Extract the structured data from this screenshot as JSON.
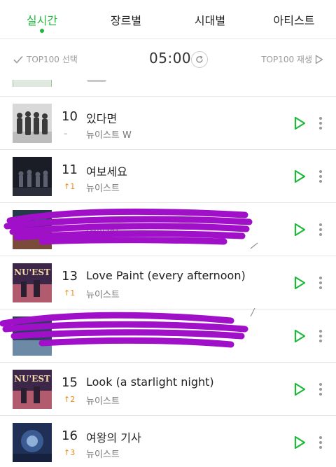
{
  "tabs": [
    {
      "label": "실시간",
      "active": true
    },
    {
      "label": "장르별",
      "active": false
    },
    {
      "label": "시대별",
      "active": false
    },
    {
      "label": "아티스트",
      "active": false
    }
  ],
  "toolbar": {
    "select_label": "TOP100 선택",
    "timer": "05:00",
    "play_label": "TOP100 재생"
  },
  "colors": {
    "accent": "#1eb83b",
    "up": "#e88a1a",
    "redaction": "#a010c8"
  },
  "songs": [
    {
      "rank": "10",
      "change": "–",
      "title": "있다면",
      "artist": "뉴이스트 W"
    },
    {
      "rank": "11",
      "change": "↑1",
      "title": "여보세요",
      "artist": "뉴이스트"
    },
    {
      "rank": "",
      "change": "",
      "title": "",
      "artist": "(Heize)",
      "redacted": true
    },
    {
      "rank": "13",
      "change": "↑1",
      "title": "Love Paint (every afternoon)",
      "artist": "뉴이스트"
    },
    {
      "rank": "",
      "change": "",
      "title": "",
      "artist": "",
      "redacted": true
    },
    {
      "rank": "15",
      "change": "↑2",
      "title": "Look (a starlight night)",
      "artist": "뉴이스트"
    },
    {
      "rank": "16",
      "change": "↑3",
      "title": "여왕의 기사",
      "artist": "뉴이스트"
    }
  ],
  "album_art": {
    "nuest": "NU'EST"
  }
}
